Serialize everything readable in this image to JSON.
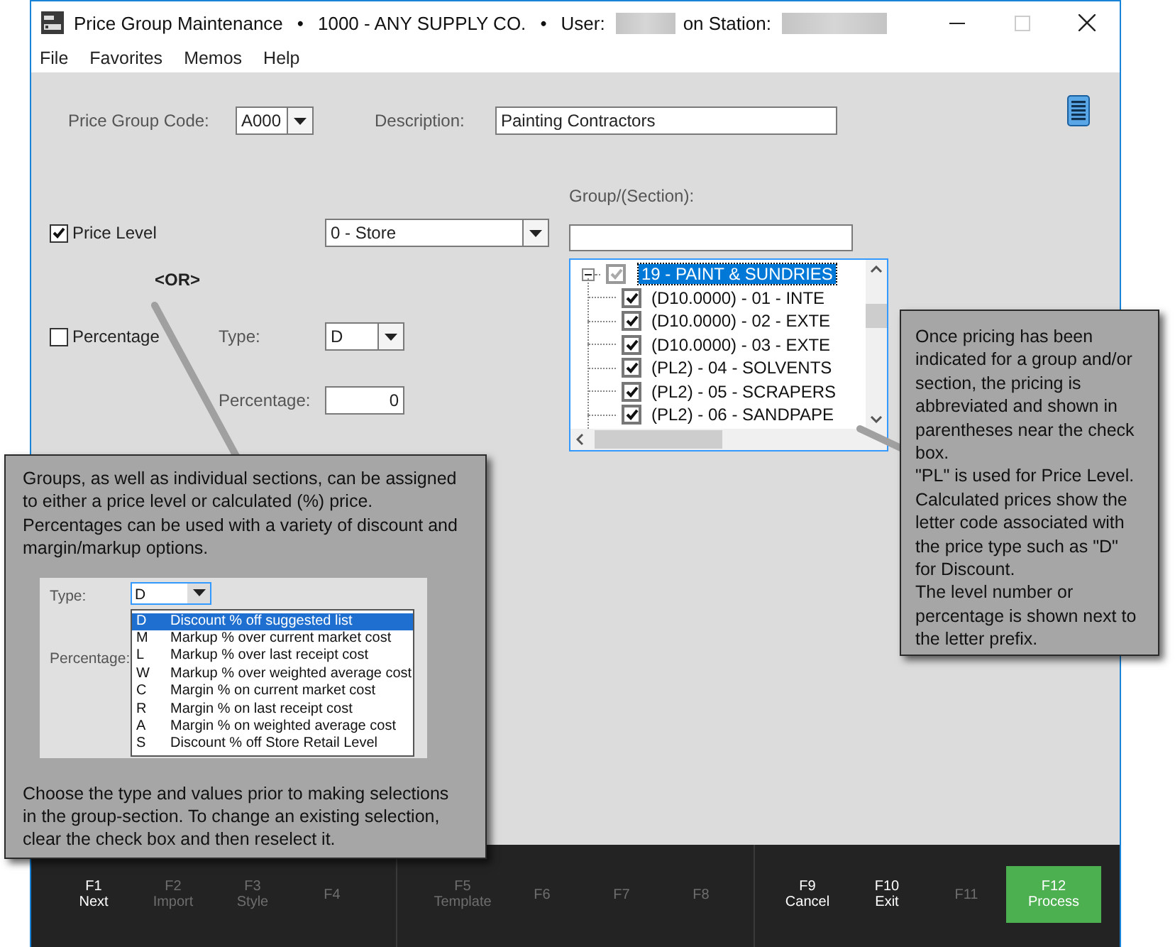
{
  "window": {
    "title_parts": [
      {
        "kind": "text",
        "text": "Price Group Maintenance"
      },
      {
        "kind": "bullet",
        "text": "•"
      },
      {
        "kind": "text",
        "text": "1000 - ANY SUPPLY CO."
      },
      {
        "kind": "bullet",
        "text": "•"
      },
      {
        "kind": "text",
        "text": "User:"
      },
      {
        "kind": "redacted"
      },
      {
        "kind": "text",
        "text": "on Station:"
      },
      {
        "kind": "redacted"
      }
    ],
    "maximize_disabled": true
  },
  "menu": [
    "File",
    "Favorites",
    "Memos",
    "Help"
  ],
  "header": {
    "code_label": "Price Group Code:",
    "code_value": "A000",
    "description_label": "Description:",
    "description_value": "Painting Contractors"
  },
  "pricing": {
    "price_level": {
      "label": "Price Level",
      "checked": true,
      "value": "0 - Store"
    },
    "or_label": "<OR>",
    "percentage": {
      "label": "Percentage",
      "checked": false,
      "type_label": "Type:",
      "type_value": "D",
      "percentage_label": "Percentage:",
      "percentage_value": "0"
    }
  },
  "group_section": {
    "label": "Group/(Section):",
    "tree": {
      "label": "19 - PAINT & SUNDRIES",
      "checked": true,
      "selected": true,
      "expanded": true,
      "children": [
        {
          "label": "(D10.0000) - 01 - INTE",
          "checked": true,
          "selected": false
        },
        {
          "label": "(D10.0000) - 02 - EXTE",
          "checked": true,
          "selected": false
        },
        {
          "label": "(D10.0000) - 03 - EXTE",
          "checked": true,
          "selected": false
        },
        {
          "label": "(PL2) - 04 - SOLVENTS",
          "checked": true,
          "selected": false
        },
        {
          "label": "(PL2) - 05 - SCRAPERS",
          "checked": true,
          "selected": false
        },
        {
          "label": "(PL2) - 06 - SANDPAPE",
          "checked": true,
          "selected": false
        }
      ]
    }
  },
  "help_callouts": {
    "types": {
      "intro": "Groups, as well as individual sections, can be assigned to either a price level or calculated (%) price. Percentages can be used with a variety of discount and margin/markup options.",
      "example": {
        "type_label": "Type:",
        "type_value": "D",
        "percentage_label": "Percentage:",
        "options": [
          {
            "code": "D",
            "description": "Discount % off suggested list",
            "selected": true
          },
          {
            "code": "M",
            "description": "Markup % over current market cost",
            "selected": false
          },
          {
            "code": "L",
            "description": "Markup % over last receipt cost",
            "selected": false
          },
          {
            "code": "W",
            "description": "Markup % over weighted average cost",
            "selected": false
          },
          {
            "code": "C",
            "description": "Margin % on current market cost",
            "selected": false
          },
          {
            "code": "R",
            "description": "Margin % on last receipt cost",
            "selected": false
          },
          {
            "code": "A",
            "description": "Margin % on weighted average cost",
            "selected": false
          },
          {
            "code": "S",
            "description": "Discount % off Store Retail Level",
            "selected": false
          }
        ]
      },
      "outro": "Choose the type and values prior to making selections in the group-section. To change an existing selection, clear the check box and then reselect it."
    },
    "pricing": {
      "paragraphs": [
        "Once pricing has been indicated for a group and/or section, the pricing is abbreviated and shown in parentheses near the check box.",
        "\"PL\" is used for Price Level.",
        "Calculated prices show the letter code associated with the price type such as \"D\" for Discount.",
        "The level number or percentage is shown next to the letter prefix."
      ]
    }
  },
  "function_key_groups": [
    {
      "keys": [
        {
          "key": "F1",
          "label": "Next",
          "disabled": false,
          "highlighted": false
        },
        {
          "key": "F2",
          "label": "Import",
          "disabled": true,
          "highlighted": false
        },
        {
          "key": "F3",
          "label": "Style",
          "disabled": true,
          "highlighted": false
        },
        {
          "key": "F4",
          "disabled": true,
          "highlighted": false
        }
      ]
    },
    {
      "keys": [
        {
          "key": "F5",
          "label": "Template",
          "disabled": true,
          "highlighted": false
        },
        {
          "key": "F6",
          "disabled": true,
          "highlighted": false
        },
        {
          "key": "F7",
          "disabled": true,
          "highlighted": false
        },
        {
          "key": "F8",
          "disabled": true,
          "highlighted": false
        }
      ]
    },
    {
      "keys": [
        {
          "key": "F9",
          "label": "Cancel",
          "disabled": false,
          "highlighted": false
        },
        {
          "key": "F10",
          "label": "Exit",
          "disabled": false,
          "highlighted": false
        },
        {
          "key": "F11",
          "disabled": true,
          "highlighted": false
        },
        {
          "key": "F12",
          "label": "Process",
          "disabled": false,
          "highlighted": true
        }
      ]
    }
  ]
}
